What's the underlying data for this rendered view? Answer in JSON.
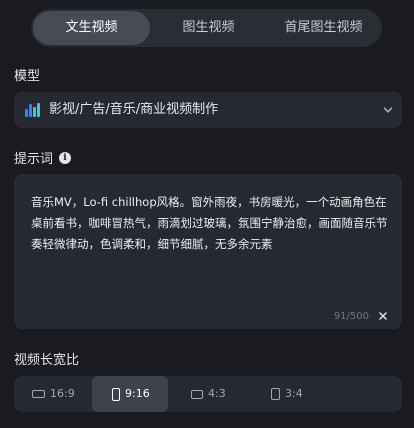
{
  "tabs": [
    {
      "label": "文生视频",
      "active": true
    },
    {
      "label": "图生视频",
      "active": false
    },
    {
      "label": "首尾图生视频",
      "active": false
    }
  ],
  "model": {
    "label": "模型",
    "selected": "影视/广告/音乐/商业视频制作",
    "icon": "bar-chart-icon"
  },
  "prompt": {
    "label": "提示词",
    "info_icon": "i",
    "text": "音乐MV，Lo-fi chillhop风格。窗外雨夜，书房暖光，一个动画角色在桌前看书，咖啡冒热气，雨滴划过玻璃，氛围宁静治愈，画面随音乐节奏轻微律动，色调柔和，细节细腻，无多余元素",
    "counter": "91/500"
  },
  "aspect_ratio": {
    "label": "视频长宽比",
    "options": [
      {
        "label": "16:9",
        "active": false
      },
      {
        "label": "9:16",
        "active": true
      },
      {
        "label": "4:3",
        "active": false
      },
      {
        "label": "3:4",
        "active": false
      }
    ]
  },
  "colors": {
    "background": "#191b20",
    "panel": "#262931",
    "active_tab": "#464b56",
    "bar_blue": "#3b82f6",
    "bar_cyan": "#3ec6e0"
  }
}
